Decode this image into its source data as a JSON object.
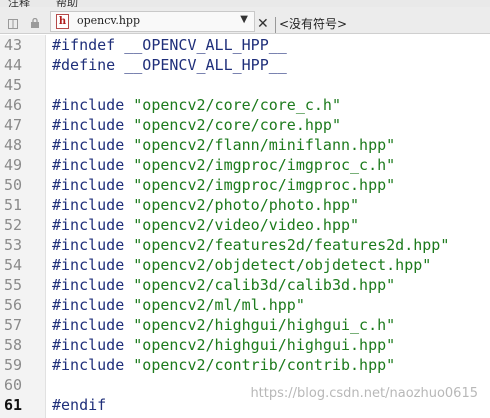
{
  "menu": {
    "items": [
      "注释",
      "帮助"
    ]
  },
  "editor_tab": {
    "file_name": "opencv.hpp",
    "file_icon_letter": "h",
    "symbol_selector": "<没有符号>",
    "dropdown_arrow": "▼",
    "close": "✕"
  },
  "editor": {
    "current_line": "61",
    "lines": [
      {
        "num": "43",
        "directive": "#ifndef",
        "arg": "__OPENCV_ALL_HPP__",
        "type": "macro"
      },
      {
        "num": "44",
        "directive": "#define",
        "arg": "__OPENCV_ALL_HPP__",
        "type": "macro"
      },
      {
        "num": "45",
        "directive": "",
        "arg": "",
        "type": "blank"
      },
      {
        "num": "46",
        "directive": "#include",
        "arg": "\"opencv2/core/core_c.h\"",
        "type": "include"
      },
      {
        "num": "47",
        "directive": "#include",
        "arg": "\"opencv2/core/core.hpp\"",
        "type": "include"
      },
      {
        "num": "48",
        "directive": "#include",
        "arg": "\"opencv2/flann/miniflann.hpp\"",
        "type": "include"
      },
      {
        "num": "49",
        "directive": "#include",
        "arg": "\"opencv2/imgproc/imgproc_c.h\"",
        "type": "include"
      },
      {
        "num": "50",
        "directive": "#include",
        "arg": "\"opencv2/imgproc/imgproc.hpp\"",
        "type": "include"
      },
      {
        "num": "51",
        "directive": "#include",
        "arg": "\"opencv2/photo/photo.hpp\"",
        "type": "include"
      },
      {
        "num": "52",
        "directive": "#include",
        "arg": "\"opencv2/video/video.hpp\"",
        "type": "include"
      },
      {
        "num": "53",
        "directive": "#include",
        "arg": "\"opencv2/features2d/features2d.hpp\"",
        "type": "include"
      },
      {
        "num": "54",
        "directive": "#include",
        "arg": "\"opencv2/objdetect/objdetect.hpp\"",
        "type": "include"
      },
      {
        "num": "55",
        "directive": "#include",
        "arg": "\"opencv2/calib3d/calib3d.hpp\"",
        "type": "include"
      },
      {
        "num": "56",
        "directive": "#include",
        "arg": "\"opencv2/ml/ml.hpp\"",
        "type": "include"
      },
      {
        "num": "57",
        "directive": "#include",
        "arg": "\"opencv2/highgui/highgui_c.h\"",
        "type": "include"
      },
      {
        "num": "58",
        "directive": "#include",
        "arg": "\"opencv2/highgui/highgui.hpp\"",
        "type": "include"
      },
      {
        "num": "59",
        "directive": "#include",
        "arg": "\"opencv2/contrib/contrib.hpp\"",
        "type": "include"
      },
      {
        "num": "60",
        "directive": "",
        "arg": "",
        "type": "blank"
      },
      {
        "num": "61",
        "directive": "#endif",
        "arg": "",
        "type": "macro"
      }
    ]
  },
  "watermark": "https://blog.csdn.net/naozhuo0615",
  "colors": {
    "keyword": "#1f2f7a",
    "string": "#1c7a1c",
    "line_number": "#8a8a8a",
    "gutter": "#f3f3f3"
  }
}
